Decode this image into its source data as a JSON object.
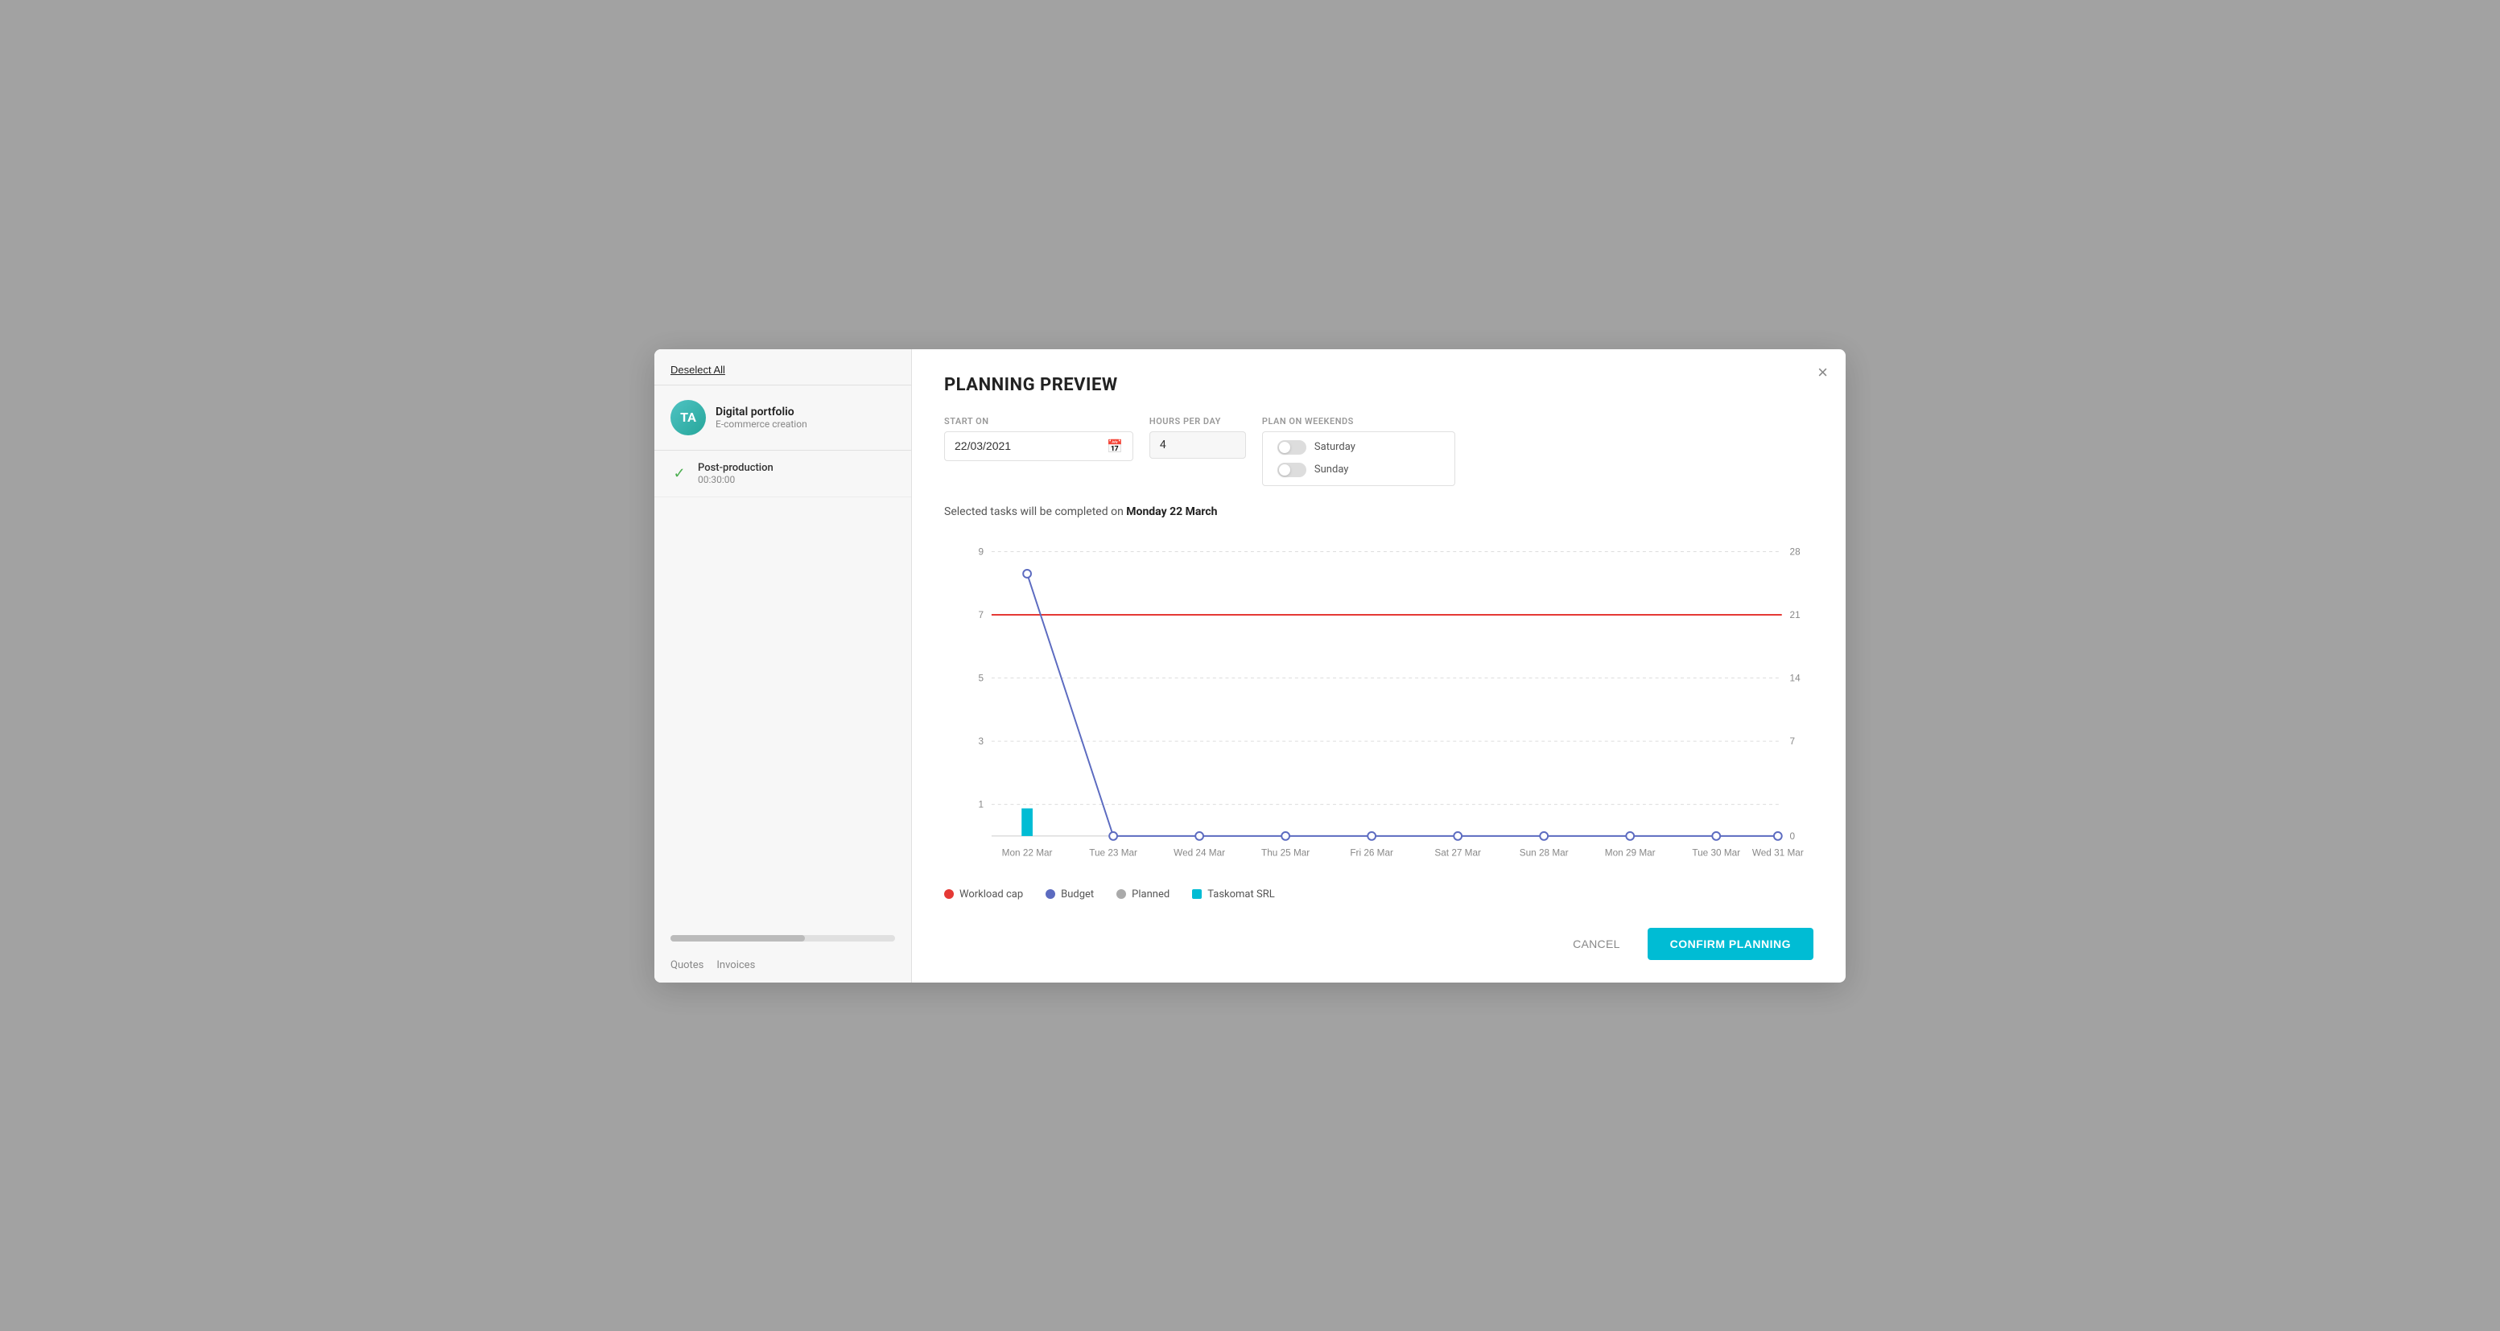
{
  "sidebar": {
    "deselect_all": "Deselect All",
    "project": {
      "avatar": "TA",
      "name": "Digital portfolio",
      "sub": "E-commerce creation"
    },
    "task": {
      "name": "Post-production",
      "time": "00:30:00"
    },
    "nav": [
      "Quotes",
      "Invoices"
    ]
  },
  "modal": {
    "title": "PLANNING PREVIEW",
    "close": "×",
    "form": {
      "start_on_label": "START ON",
      "start_on_value": "22/03/2021",
      "hours_per_day_label": "HOURS PER DAY",
      "hours_per_day_value": "4",
      "weekends_label": "PLAN ON WEEKENDS",
      "saturday_label": "Saturday",
      "sunday_label": "Sunday"
    },
    "completion_text_prefix": "Selected tasks will be completed on ",
    "completion_date": "Monday 22 March",
    "chart": {
      "y_left_labels": [
        "9",
        "7",
        "5",
        "3",
        "1"
      ],
      "y_right_labels": [
        "28",
        "21",
        "14",
        "7",
        "0"
      ],
      "x_labels": [
        "Mon 22 Mar",
        "Tue 23 Mar",
        "Wed 24 Mar",
        "Thu 25 Mar",
        "Fri 26 Mar",
        "Sat 27 Mar",
        "Sun 28 Mar",
        "Mon 29 Mar",
        "Tue 30 Mar",
        "Wed 31 Mar"
      ],
      "legend": [
        {
          "label": "Workload cap",
          "color": "#e53935"
        },
        {
          "label": "Budget",
          "color": "#5c6bc0"
        },
        {
          "label": "Planned",
          "color": "#aaa"
        },
        {
          "label": "Taskomat SRL",
          "color": "#00bcd4"
        }
      ]
    },
    "cancel_label": "CANCEL",
    "confirm_label": "CONFIRM PLANNING"
  }
}
